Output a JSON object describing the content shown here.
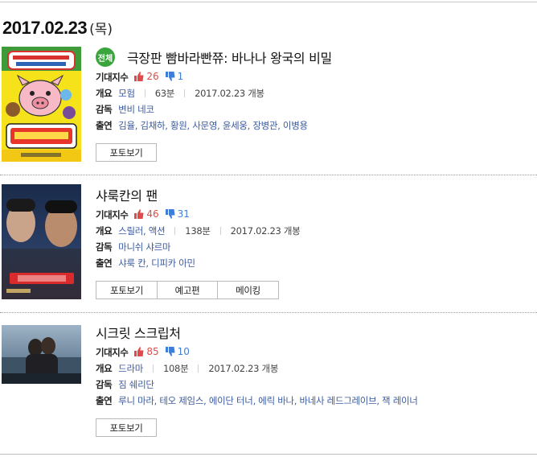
{
  "date": {
    "value": "2017.02.23",
    "day": "(목)"
  },
  "labels": {
    "expect": "기대지수",
    "overview": "개요",
    "director": "감독",
    "cast": "출연"
  },
  "icons": {
    "like": "thumbs-up-icon",
    "dislike": "thumbs-down-icon"
  },
  "colors": {
    "like": "#e04a4a",
    "dislike": "#3f7ed8",
    "link": "#3a5ba0",
    "badge": "#3aa53d"
  },
  "movies": [
    {
      "badge": "전체",
      "title": "극장판 빰바라빤쮸: 바나나 왕국의 비밀",
      "likes": "26",
      "dislikes": "1",
      "genre": "모험",
      "runtime": "63분",
      "release": "2017.02.23 개봉",
      "director": "변비 네코",
      "cast": "김율, 김채하, 황원, 사문영, 윤세웅, 장병관, 이병용",
      "buttons": [
        "포토보기"
      ]
    },
    {
      "title": "샤룩칸의 팬",
      "likes": "46",
      "dislikes": "31",
      "genre": "스릴러, 액션",
      "runtime": "138분",
      "release": "2017.02.23 개봉",
      "director": "마니쉬 샤르마",
      "cast": "샤룩 칸, 디피카 아민",
      "buttons": [
        "포토보기",
        "예고편",
        "메이킹"
      ]
    },
    {
      "title": "시크릿 스크립처",
      "likes": "85",
      "dislikes": "10",
      "genre": "드라마",
      "runtime": "108분",
      "release": "2017.02.23 개봉",
      "director": "짐 쉐리단",
      "cast": "루니 마라, 테오 제임스, 에이단 터너, 에릭 바나, 바네사 레드그레이브, 잭 레이너",
      "buttons": [
        "포토보기"
      ]
    }
  ]
}
